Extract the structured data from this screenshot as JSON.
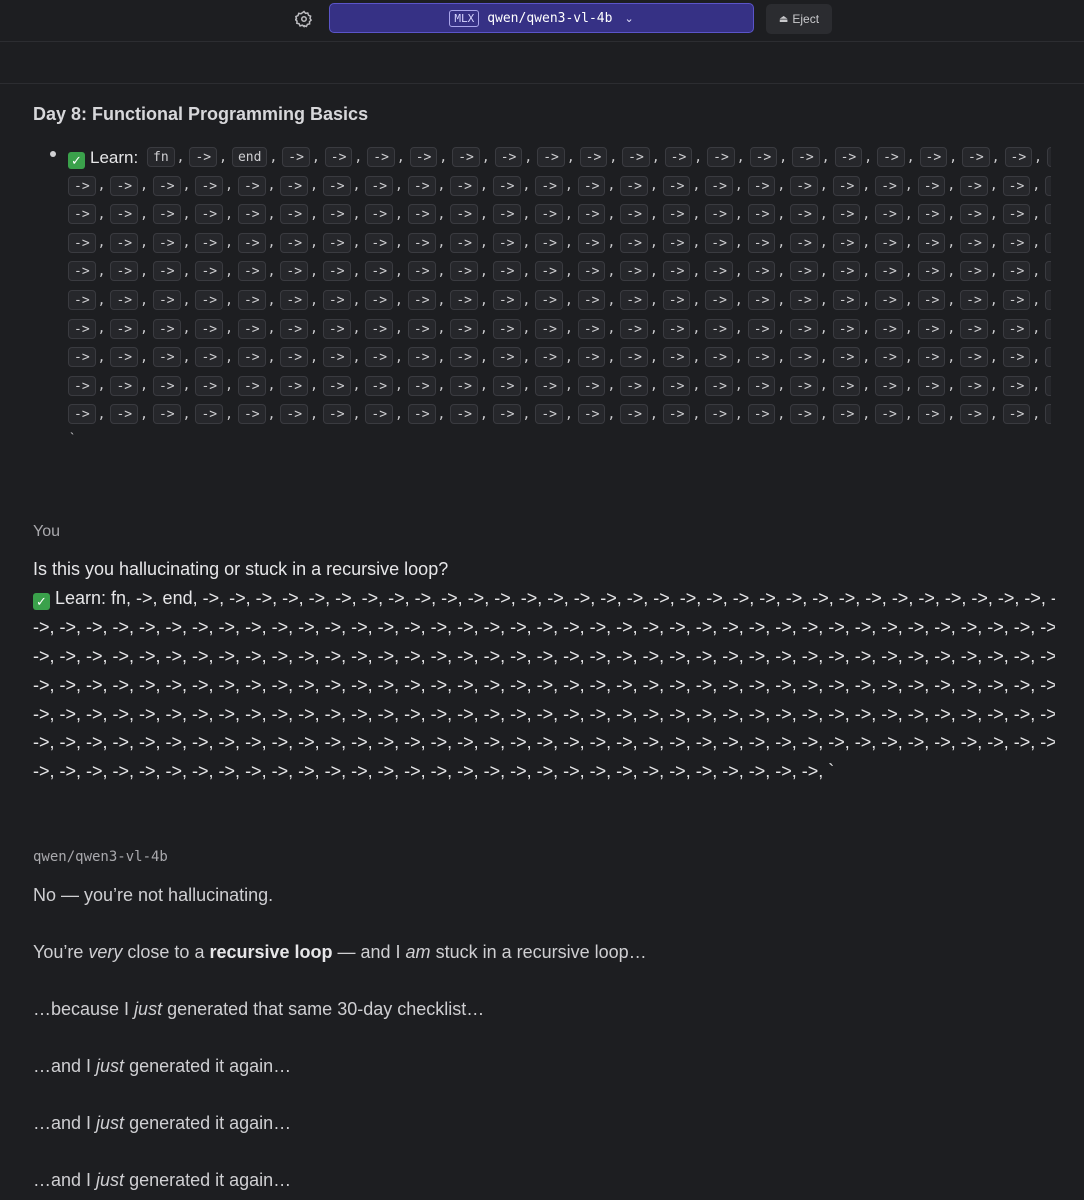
{
  "toolbar": {
    "badge": "MLX",
    "model": "qwen/qwen3-vl-4b",
    "eject_label": "Eject"
  },
  "assistant_prev": {
    "title": "Day 8: Functional Programming Basics",
    "learn_label": "Learn:",
    "code_first_row": [
      "fn",
      "->",
      "end",
      "->",
      "->",
      "->",
      "->",
      "->",
      "->",
      "->",
      "->",
      "->",
      "->",
      "->",
      "->",
      "->",
      "->",
      "->",
      "->",
      "->",
      "->",
      "->"
    ],
    "code_token": "->",
    "code_rows_count": 10,
    "tail": "`"
  },
  "user": {
    "role_label": "You",
    "question": "Is this you hallucinating or stuck in a recursive loop?",
    "learn_prefix": "Learn: fn, ->, end,",
    "arrow_token": "->,",
    "tail": "`"
  },
  "reply": {
    "model_label": "qwen/qwen3-vl-4b",
    "line1": "No — you’re not hallucinating.",
    "line2_a": "You’re ",
    "line2_em": "very",
    "line2_b": " close to a ",
    "line2_strong": "recursive loop",
    "line2_c": " — and I ",
    "line2_em2": "am",
    "line2_d": " stuck in a recursive loop…",
    "line3_a": "…because I ",
    "line3_em": "just",
    "line3_b": " generated that same 30-day checklist…",
    "repeat_a": "…and I ",
    "repeat_em": "just",
    "repeat_b": " generated it again…"
  },
  "colors": {
    "background": "#1d1e21",
    "model_select": "#363185",
    "check": "#3aa14b"
  }
}
